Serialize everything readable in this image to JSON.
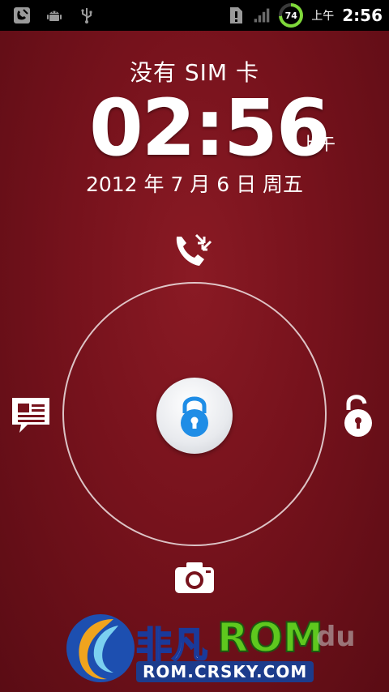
{
  "status_bar": {
    "left_icons": [
      "phone-missed-icon",
      "android-debug-icon",
      "usb-icon"
    ],
    "right_icons": [
      "alert-icon",
      "signal-icon"
    ],
    "battery_level": "74",
    "battery_color": "#7fd83a",
    "ampm": "上午",
    "time": "2:56"
  },
  "lockscreen": {
    "carrier": "没有 SIM 卡",
    "clock": "02:56",
    "clock_ampm": "上午",
    "date": "2012 年 7 月 6 日 周五",
    "targets": [
      "phone-icon",
      "message-icon",
      "unlock-icon",
      "camera-icon"
    ],
    "center": "lock-icon"
  },
  "watermark": {
    "brand_cn": "非凡",
    "brand_rom": "ROM",
    "url": "ROM.CRSKY.COM",
    "extra": "du"
  },
  "colors": {
    "background": "#76121c",
    "lock_accent": "#1f8de6"
  }
}
